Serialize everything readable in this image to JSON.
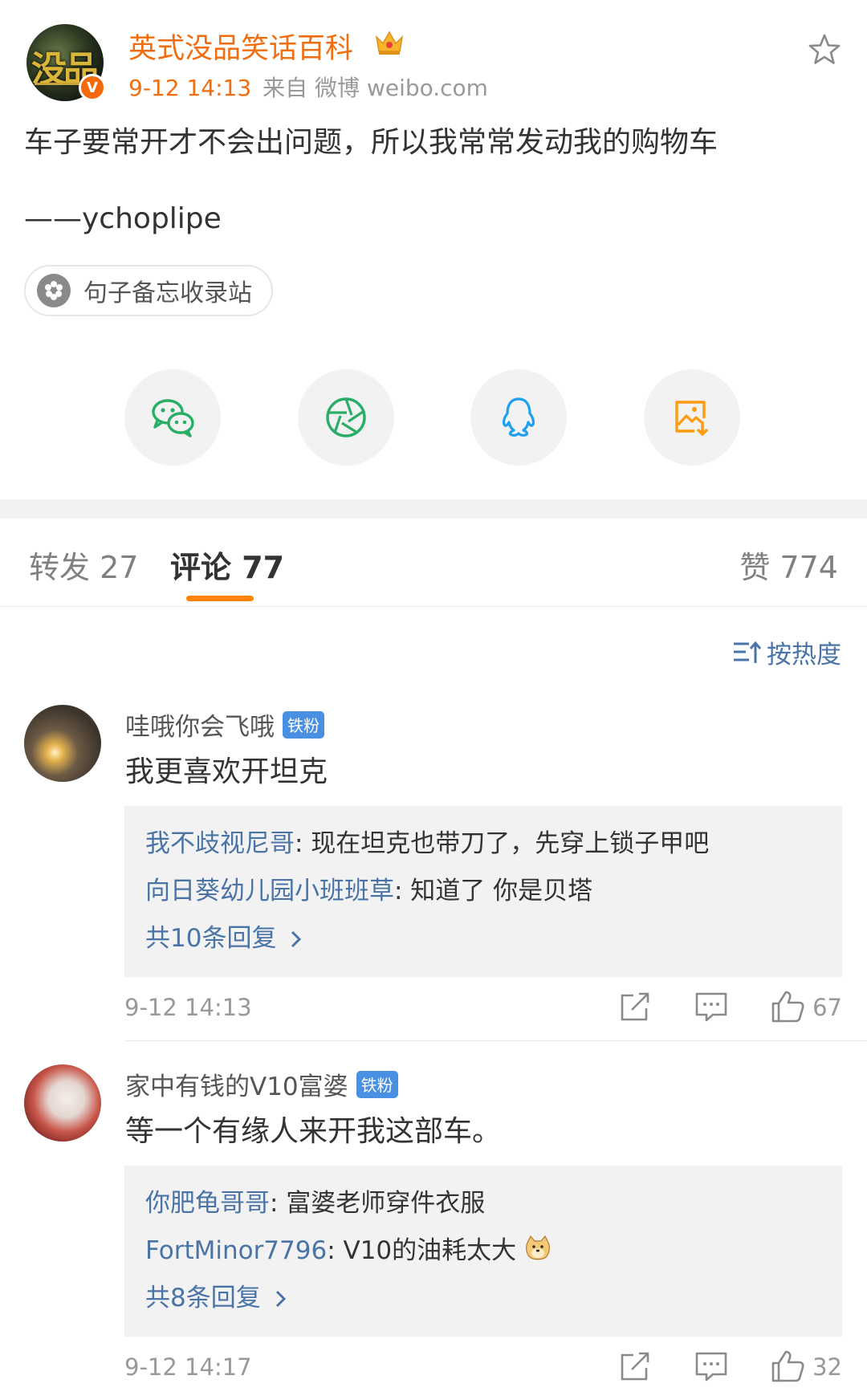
{
  "post": {
    "author": "英式没品笑话百科",
    "verified_badge": "V",
    "time": "9-12 14:13",
    "source": "来自 微博 weibo.com",
    "text": "车子要常开才不会出问题，所以我常常发动我的购物车",
    "attribution": "——ychoplipe",
    "topic": "句子备忘收录站",
    "colors": {
      "brand_orange": "#f26d0f",
      "link_blue": "#4a74a6",
      "tab_underline": "#ff8200"
    }
  },
  "share": {
    "items": [
      {
        "icon": "wechat-icon",
        "color": "#2aae67"
      },
      {
        "icon": "moments-icon",
        "color": "#2aae67"
      },
      {
        "icon": "qq-icon",
        "color": "#1ea0f0"
      },
      {
        "icon": "save-image-icon",
        "color": "#ff9b0f"
      }
    ]
  },
  "tabs": {
    "repost": "转发 27",
    "comments": "评论 77",
    "likes": "赞 774"
  },
  "sort": {
    "label": "按热度"
  },
  "comments": [
    {
      "user": "哇哦你会飞哦",
      "badge": "铁粉",
      "text": "我更喜欢开坦克",
      "replies": [
        {
          "user": "我不歧视尼哥",
          "text": ": 现在坦克也带刀了，先穿上锁子甲吧"
        },
        {
          "user": "向日葵幼儿园小班班草",
          "text": ": 知道了 你是贝塔"
        }
      ],
      "more_replies": "共10条回复",
      "time": "9-12 14:13",
      "likes": "67"
    },
    {
      "user": "家中有钱的V10富婆",
      "badge": "铁粉",
      "text": "等一个有缘人来开我这部车。",
      "replies": [
        {
          "user": "你肥龟哥哥",
          "text": ": 富婆老师穿件衣服"
        },
        {
          "user": "FortMinor7796",
          "text": ": V10的油耗太大",
          "emoji": "doge-emoji-icon"
        }
      ],
      "more_replies": "共8条回复",
      "time": "9-12 14:17",
      "likes": "32"
    }
  ]
}
